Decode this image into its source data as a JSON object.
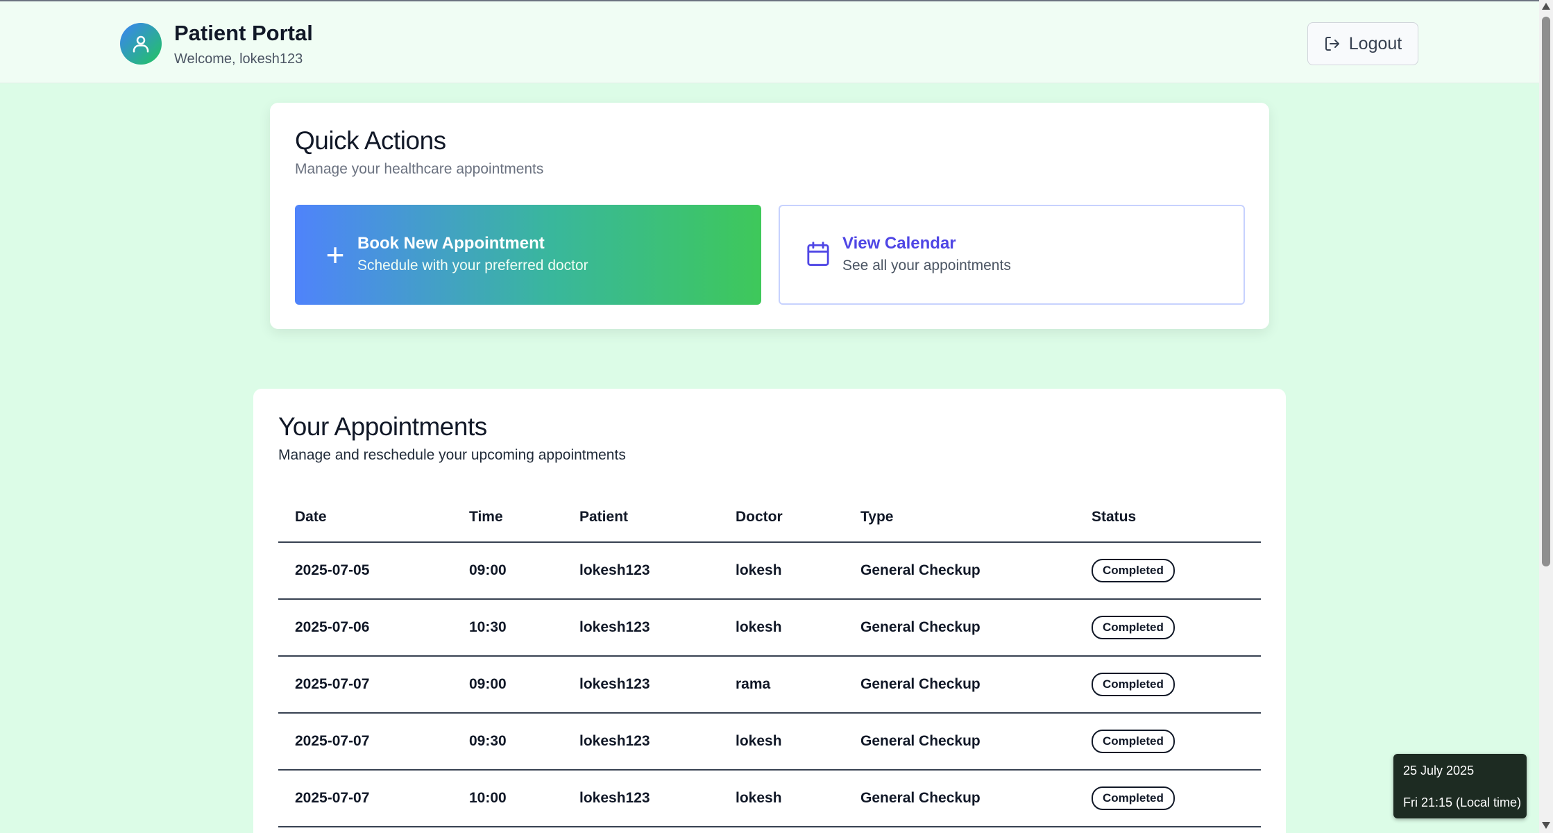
{
  "header": {
    "title": "Patient Portal",
    "welcome": "Welcome, lokesh123",
    "avatar_icon": "user-icon",
    "logout_label": "Logout",
    "logout_icon": "logout-icon"
  },
  "quick_actions": {
    "title": "Quick Actions",
    "subtitle": "Manage your healthcare appointments",
    "book": {
      "icon": "plus-icon",
      "title": "Book New Appointment",
      "subtitle": "Schedule with your preferred doctor"
    },
    "calendar": {
      "icon": "calendar-icon",
      "title": "View Calendar",
      "subtitle": "See all your appointments"
    }
  },
  "appointments": {
    "title": "Your Appointments",
    "subtitle": "Manage and reschedule your upcoming appointments",
    "columns": [
      "Date",
      "Time",
      "Patient",
      "Doctor",
      "Type",
      "Status"
    ],
    "rows": [
      {
        "date": "2025-07-05",
        "time": "09:00",
        "patient": "lokesh123",
        "doctor": "lokesh",
        "type": "General Checkup",
        "status": "Completed"
      },
      {
        "date": "2025-07-06",
        "time": "10:30",
        "patient": "lokesh123",
        "doctor": "lokesh",
        "type": "General Checkup",
        "status": "Completed"
      },
      {
        "date": "2025-07-07",
        "time": "09:00",
        "patient": "lokesh123",
        "doctor": "rama",
        "type": "General Checkup",
        "status": "Completed"
      },
      {
        "date": "2025-07-07",
        "time": "09:30",
        "patient": "lokesh123",
        "doctor": "lokesh",
        "type": "General Checkup",
        "status": "Completed"
      },
      {
        "date": "2025-07-07",
        "time": "10:00",
        "patient": "lokesh123",
        "doctor": "lokesh",
        "type": "General Checkup",
        "status": "Completed"
      }
    ]
  },
  "clock": {
    "date": "25 July 2025",
    "time": "Fri 21:15 (Local time)"
  },
  "colors": {
    "page_background": "#dcfce7",
    "header_background": "#f0fdf4",
    "gradient_start": "#4f83fb",
    "gradient_end": "#3ec85a",
    "calendar_accent": "#4f46e5"
  }
}
